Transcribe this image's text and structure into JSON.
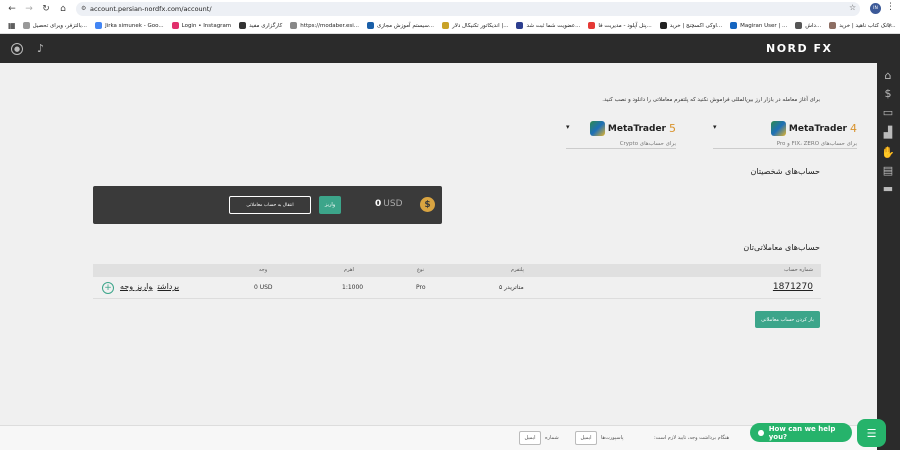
{
  "browser": {
    "url": "account.persian-nordfx.com/account/",
    "profile_initials": "IN",
    "bookmarks": [
      {
        "label": "بالتزفر، ویرای تحصیل...",
        "color": "#999"
      },
      {
        "label": "Jirka simunek - Goo...",
        "color": "#4285f4"
      },
      {
        "label": "Login • Instagram",
        "color": "#e1306c"
      },
      {
        "label": "کارگزاری مفید",
        "color": "#333"
      },
      {
        "label": "https://modaber.esi...",
        "color": "#888"
      },
      {
        "label": "سیستم آموزش مجازی...",
        "color": "#1a5fa8"
      },
      {
        "label": "اندیکاتور تکنیکال دلار |...",
        "color": "#c9a227"
      },
      {
        "label": "عضویت شما ثبت شد...",
        "color": "#2c3e8f"
      },
      {
        "label": "پنل آپلود - مدیریت فا...",
        "color": "#e53935"
      },
      {
        "label": "اوکی اکسچنج | خرید...",
        "color": "#222"
      },
      {
        "label": "Magiran User | ...",
        "color": "#1565c0"
      },
      {
        "label": "داش...",
        "color": "#555"
      },
      {
        "label": "بانک کتاب ناهید | خرید...",
        "color": "#8d6e63"
      }
    ]
  },
  "header": {
    "logo_text": "NORD FX"
  },
  "intro": "برای آغاز معامله در بازار ارز بین‌المللی فراموش نکنید که پلتفرم معاملاتی را دانلود و نصب کنید.",
  "platforms": [
    {
      "name": "MetaTrader",
      "version": "4",
      "desc": "برای حساب‌های FIX، ZERO و Pro"
    },
    {
      "name": "MetaTrader",
      "version": "5",
      "desc": "برای حساب‌های Crypto"
    }
  ],
  "personal": {
    "title": "حساب‌های شخصیتان",
    "coin_symbol": "$",
    "balance": "0",
    "currency": "USD",
    "deposit_label": "واریز",
    "transfer_placeholder": "انتقال به حساب معاملاتی"
  },
  "trading": {
    "title": "حساب‌های معاملاتی‌تان",
    "columns": {
      "account": "شماره حساب",
      "platform": "پلتفرم",
      "type": "نوع",
      "leverage": "اهرم",
      "balance": "وجه"
    },
    "rows": [
      {
        "account": "1871270",
        "platform": "متاتریدر ۵",
        "type": "Pro",
        "leverage": "1:1000",
        "balance": "0 USD",
        "withdraw": "برداشت",
        "deposit": "واریز وجه"
      }
    ],
    "add_account_label": "باز کردن حساب معاملاتی"
  },
  "footer": {
    "notice": "هنگام برداشت وجه، تایید لازم است:",
    "password_label": "پاسپورت‌ها",
    "password_btn": "ایمیل",
    "other_label": "شماره",
    "other_btn": "ایمیل"
  },
  "chat": {
    "label": "How can we help you?"
  }
}
